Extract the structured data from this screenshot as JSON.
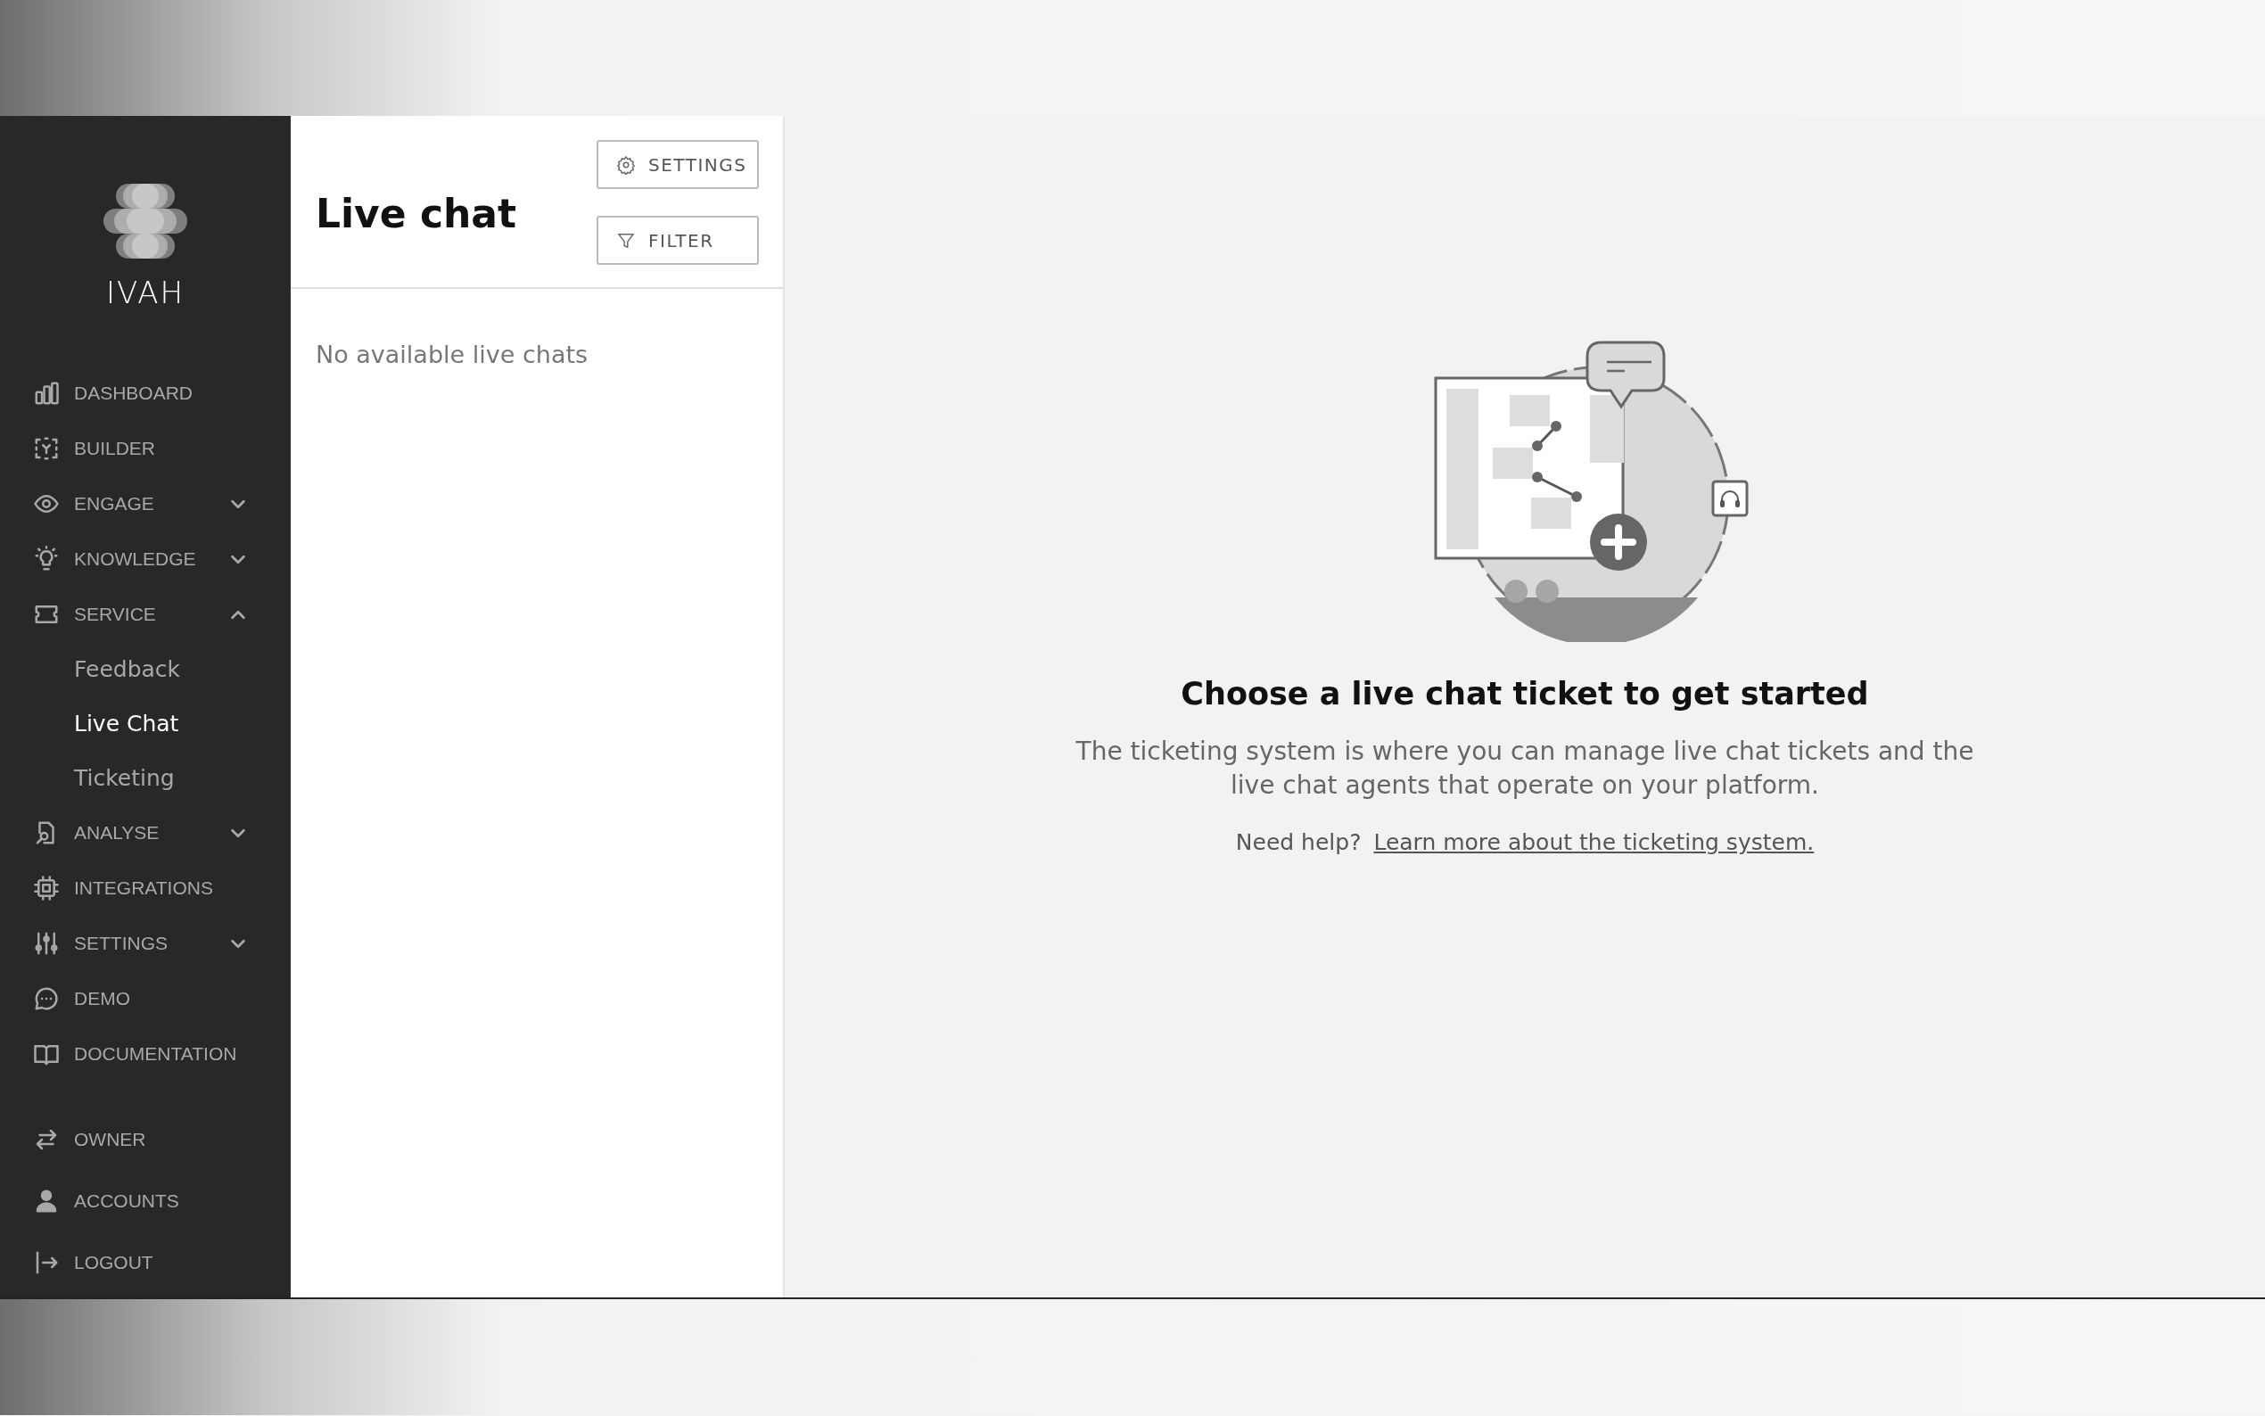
{
  "sidebar": {
    "logo_text": "IVAH",
    "items": [
      {
        "label": "DASHBOARD",
        "kind": "link",
        "selected": false
      },
      {
        "label": "BUILDER",
        "kind": "link",
        "selected": false
      },
      {
        "label": "ENGAGE",
        "kind": "group",
        "selected": false,
        "expanded": false
      },
      {
        "label": "KNOWLEDGE",
        "kind": "group",
        "selected": false,
        "expanded": false
      },
      {
        "label": "SERVICE",
        "kind": "group",
        "selected": false,
        "expanded": true,
        "children": [
          {
            "label": "Feedback",
            "selected": false
          },
          {
            "label": "Live Chat",
            "selected": true
          },
          {
            "label": "Ticketing",
            "selected": false
          }
        ]
      },
      {
        "label": "ANALYSE",
        "kind": "group",
        "selected": false,
        "expanded": false
      },
      {
        "label": "INTEGRATIONS",
        "kind": "link",
        "selected": false
      },
      {
        "label": "SETTINGS",
        "kind": "group",
        "selected": false,
        "expanded": false
      },
      {
        "label": "DEMO",
        "kind": "link",
        "selected": false
      },
      {
        "label": "DOCUMENTATION",
        "kind": "link",
        "selected": false
      }
    ],
    "footer_items": [
      {
        "label": "OWNER"
      },
      {
        "label": "ACCOUNTS"
      },
      {
        "label": "LOGOUT"
      }
    ]
  },
  "list_panel": {
    "title": "Live chat",
    "buttons": [
      {
        "label": "SETTINGS"
      },
      {
        "label": "FILTER"
      }
    ],
    "empty_text": "No available live chats"
  },
  "detail_panel": {
    "heading": "Choose a live chat ticket to get started",
    "description": "The ticketing system is where you can manage live chat tickets and the live chat agents that operate on your platform.",
    "help_text": "Need help?",
    "help_link": "Learn more about the ticketing system."
  }
}
